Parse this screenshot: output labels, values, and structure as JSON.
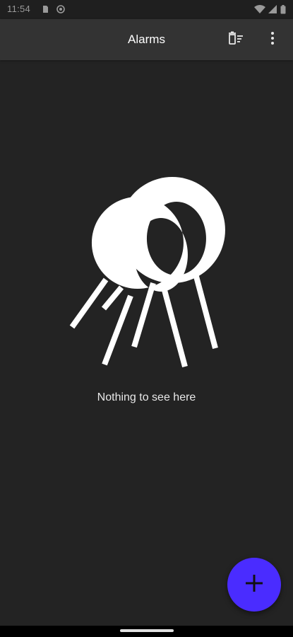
{
  "status_bar": {
    "time": "11:54",
    "icons": [
      "sim-card-icon",
      "at-sign-icon",
      "wifi-icon",
      "battery-icon"
    ]
  },
  "app_bar": {
    "title": "Alarms",
    "actions": [
      "delete-sweep-icon",
      "more-vert-icon"
    ]
  },
  "empty_state": {
    "illustration": "magnifying-glasses-icon",
    "message": "Nothing to see here"
  },
  "fab": {
    "icon": "plus-icon",
    "color": "#4a2cff"
  },
  "colors": {
    "background": "#232323",
    "app_bar": "#333333",
    "status_bar": "#1f1f1f"
  }
}
